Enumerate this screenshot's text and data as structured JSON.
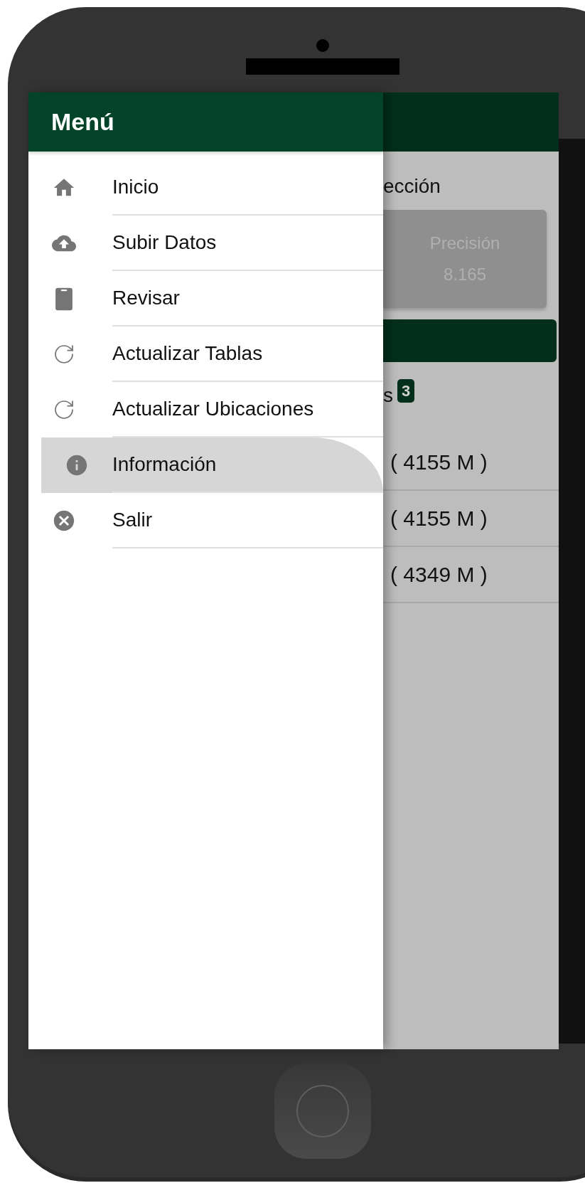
{
  "drawer": {
    "title": "Menú",
    "items": [
      {
        "kind": "home",
        "label": "Inicio",
        "selected": false
      },
      {
        "kind": "upload",
        "label": "Subir Datos",
        "selected": false
      },
      {
        "kind": "clipboard",
        "label": "Revisar",
        "selected": false
      },
      {
        "kind": "refresh",
        "label": "Actualizar Tablas",
        "selected": false
      },
      {
        "kind": "refresh",
        "label": "Actualizar Ubicaciones",
        "selected": false
      },
      {
        "kind": "info",
        "label": "Información",
        "selected": true
      },
      {
        "kind": "exit",
        "label": "Salir",
        "selected": false
      }
    ]
  },
  "background": {
    "heading": "ección",
    "card": {
      "label": "Precisión",
      "value": "8.165"
    },
    "section": {
      "label": "s",
      "count": "3"
    },
    "rows": [
      "( 4155 M )",
      "( 4155 M )",
      "( 4349 M )"
    ]
  }
}
